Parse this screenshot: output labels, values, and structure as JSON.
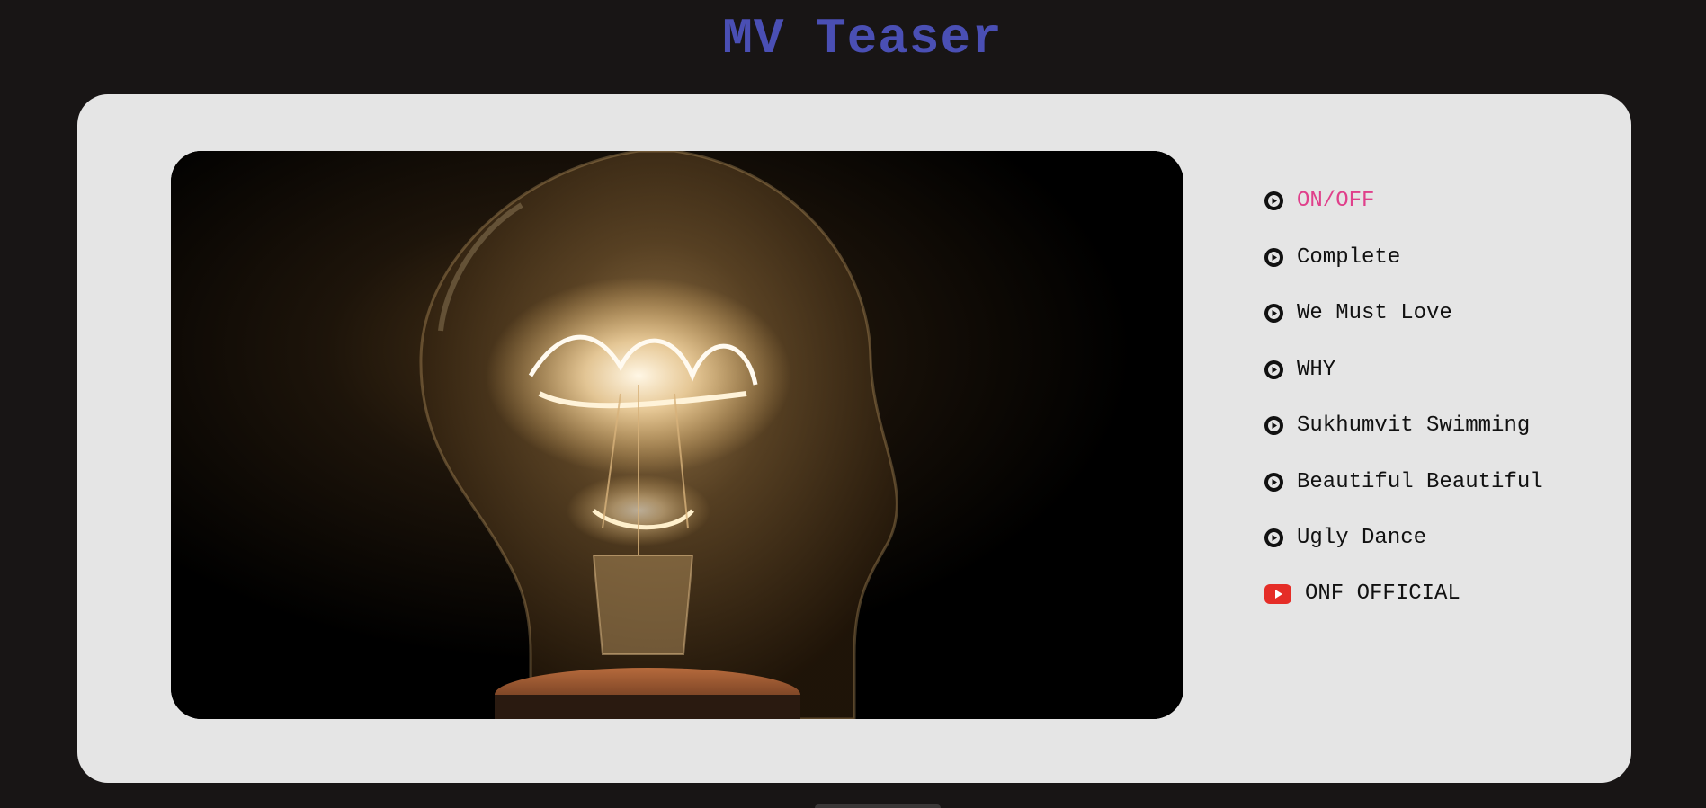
{
  "header": {
    "title": "MV Teaser"
  },
  "video": {
    "icon": "light-bulb-still"
  },
  "playlist": {
    "items": [
      {
        "label": "ON/OFF",
        "icon": "play-circle-icon",
        "active": true
      },
      {
        "label": "Complete",
        "icon": "play-circle-icon",
        "active": false
      },
      {
        "label": "We Must Love",
        "icon": "play-circle-icon",
        "active": false
      },
      {
        "label": "WHY",
        "icon": "play-circle-icon",
        "active": false
      },
      {
        "label": "Sukhumvit Swimming",
        "icon": "play-circle-icon",
        "active": false
      },
      {
        "label": "Beautiful Beautiful",
        "icon": "play-circle-icon",
        "active": false
      },
      {
        "label": "Ugly Dance",
        "icon": "play-circle-icon",
        "active": false
      }
    ]
  },
  "channel_link": {
    "label": "ONF OFFICIAL",
    "icon": "youtube-icon"
  },
  "colors": {
    "background": "#181515",
    "title": "#4a4fb4",
    "card": "#e5e5e5",
    "active_item": "#e0408b",
    "youtube_red": "#e52d27"
  }
}
